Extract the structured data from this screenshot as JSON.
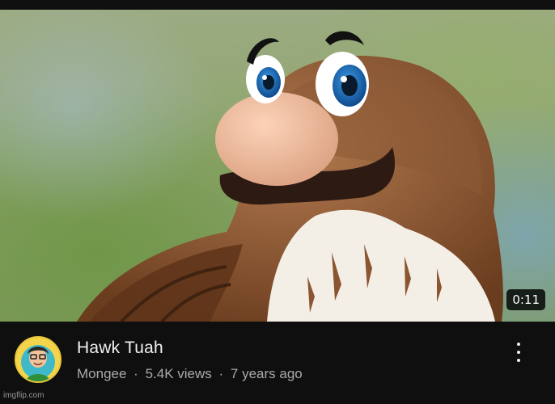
{
  "video": {
    "title": "Hawk Tuah",
    "duration": "0:11",
    "channel": "Mongee",
    "views": "5.4K views",
    "age": "7 years ago",
    "separator": "·"
  },
  "icons": {
    "more": "more-vert-icon",
    "avatar": "channel-avatar"
  },
  "watermark": "imgflip.com",
  "colors": {
    "background": "#0f0f0f",
    "title_text": "#f1f1f1",
    "meta_text": "#aaaaaa",
    "badge_bg": "#000000"
  }
}
